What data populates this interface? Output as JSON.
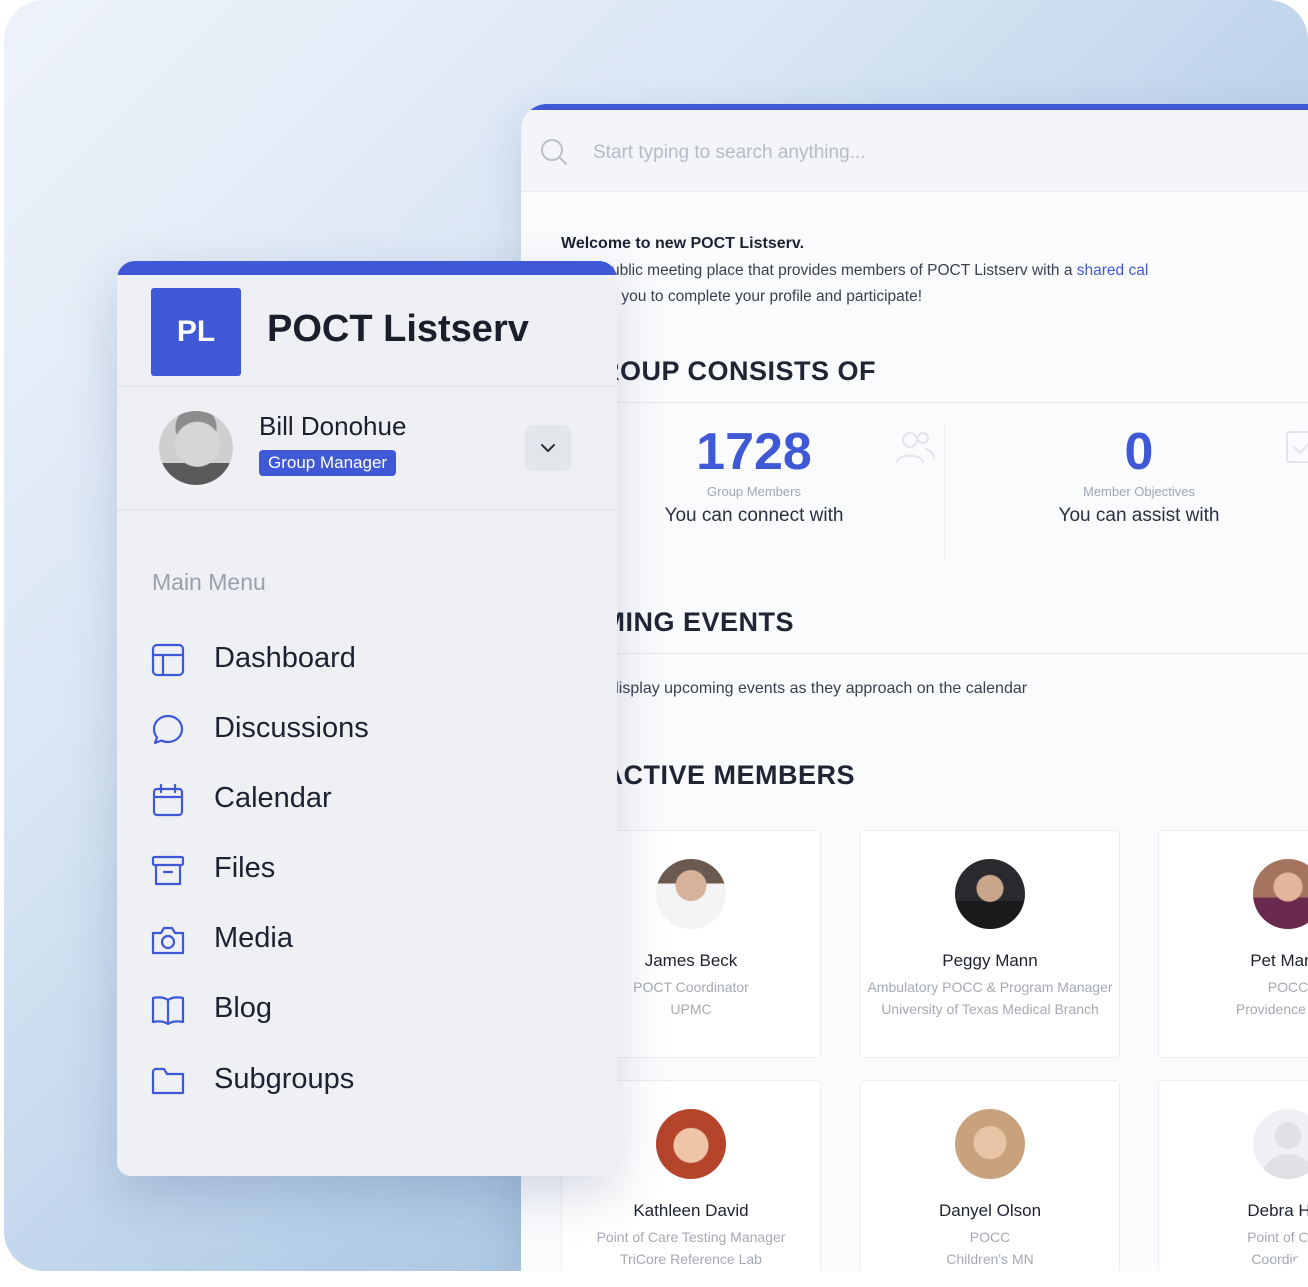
{
  "colors": {
    "accent": "#3f58d6",
    "sidebar_bg": "#eef0f4",
    "text_dark": "#1d2230",
    "text_muted": "#a4a9b4"
  },
  "search": {
    "placeholder": "Start typing to search anything..."
  },
  "welcome": {
    "title": "Welcome to new POCT Listserv.",
    "line1_text": "e is a public meeting place that provides members of POCT Listserv with a ",
    "line1_link": "shared cal",
    "line2": "courage you to complete your profile and participate!"
  },
  "sections": {
    "group": "; GROUP CONSISTS OF",
    "events": "COMING EVENTS",
    "members": "ST ACTIVE MEMBERS"
  },
  "stats": [
    {
      "value": "1728",
      "label": "Group Members",
      "sub": "You can connect with",
      "icon": "users-icon"
    },
    {
      "value": "0",
      "label": "Member Objectives",
      "sub": "You can assist with",
      "icon": "check-square-icon"
    }
  ],
  "events_text": "ea will display upcoming events as they approach on the calendar",
  "members": [
    {
      "name": "James Beck",
      "role": "POCT Coordinator",
      "org": "UPMC"
    },
    {
      "name": "Peggy Mann",
      "role": "Ambulatory POCC & Program Manager",
      "org": "University of Texas Medical Branch"
    },
    {
      "name": "Pet Manic",
      "role": "POCC",
      "org": "Providence Medi"
    },
    {
      "name": "Kathleen David",
      "role": "Point of Care Testing Manager",
      "org": "TriCore Reference Lab"
    },
    {
      "name": "Danyel Olson",
      "role": "POCC",
      "org": "Children's MN"
    },
    {
      "name": "Debra Hov",
      "role": "Point of Care",
      "org": "Coordinator"
    }
  ],
  "sidebar": {
    "logo_initials": "PL",
    "brand": "POCT Listserv",
    "user": {
      "name": "Bill Donohue",
      "badge": "Group Manager"
    },
    "menu_title": "Main Menu",
    "items": [
      {
        "label": "Dashboard",
        "icon": "dashboard-icon"
      },
      {
        "label": "Discussions",
        "icon": "chat-bubble-icon"
      },
      {
        "label": "Calendar",
        "icon": "calendar-icon"
      },
      {
        "label": "Files",
        "icon": "archive-box-icon"
      },
      {
        "label": "Media",
        "icon": "camera-icon"
      },
      {
        "label": "Blog",
        "icon": "book-icon"
      },
      {
        "label": "Subgroups",
        "icon": "folder-icon"
      }
    ]
  }
}
